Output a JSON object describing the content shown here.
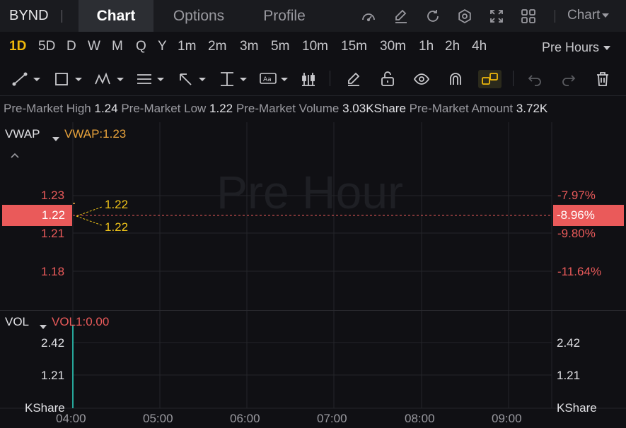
{
  "header": {
    "ticker": "BYND",
    "tabs": [
      {
        "label": "Chart",
        "active": true
      },
      {
        "label": "Options",
        "active": false
      },
      {
        "label": "Profile",
        "active": false
      }
    ],
    "icons": [
      "gauge-icon",
      "edit-icon",
      "refresh-icon",
      "gear-icon",
      "fullscreen-icon",
      "grid-icon"
    ],
    "chart_menu_label": "Chart"
  },
  "timeframes": {
    "items": [
      "1D",
      "5D",
      "D",
      "W",
      "M",
      "Q",
      "Y",
      "1m",
      "2m",
      "3m",
      "5m",
      "10m",
      "15m",
      "30m",
      "1h",
      "2h",
      "4h"
    ],
    "active": "1D",
    "session_label": "Pre Hours"
  },
  "tools": [
    "trend-line",
    "rectangle",
    "pattern",
    "fib",
    "arrow",
    "price-range",
    "text",
    "indicator",
    "pen",
    "unlock",
    "eye",
    "magnet",
    "link-active",
    "undo",
    "redo",
    "delete"
  ],
  "info": {
    "high_label": "Pre-Market High",
    "high_value": "1.24",
    "low_label": "Pre-Market Low",
    "low_value": "1.22",
    "volume_label": "Pre-Market Volume",
    "volume_value": "3.03KShare",
    "amount_label": "Pre-Market Amount",
    "amount_value": "3.72K"
  },
  "price_pane": {
    "indicator_name": "VWAP",
    "indicator_value": "VWAP:1.23",
    "watermark": "Pre Hour",
    "current_price": "1.22",
    "current_pct": "-8.96%",
    "annotations": [
      "1.22",
      "1.22"
    ],
    "left_ticks": [
      "1.23",
      "1.21",
      "1.18"
    ],
    "right_ticks": [
      "-7.97%",
      "-9.80%",
      "-11.64%"
    ]
  },
  "volume_pane": {
    "indicator_name": "VOL",
    "indicator_value": "VOL1:0.00",
    "left_ticks": [
      "2.42",
      "1.21"
    ],
    "right_ticks": [
      "2.42",
      "1.21"
    ],
    "unit_left": "KShare",
    "unit_right": "KShare"
  },
  "x_axis": [
    "04:00",
    "05:00",
    "06:00",
    "07:00",
    "08:00",
    "09:00"
  ],
  "colors": {
    "background": "#101014",
    "accent": "#f0b90b",
    "down": "#ea5a5a",
    "up": "#26a69a",
    "vwap": "#e8a33c"
  },
  "chart_data": {
    "type": "line",
    "x": [
      "04:00"
    ],
    "series": [
      {
        "values": [
          1.22
        ]
      }
    ],
    "volume": {
      "x": [
        "04:00"
      ],
      "values": [
        2.42
      ]
    }
  }
}
